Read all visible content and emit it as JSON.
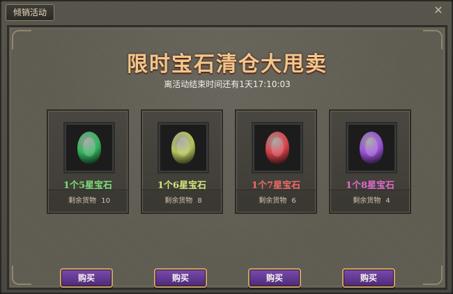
{
  "window": {
    "tab_label": "倾销活动",
    "close_symbol": "✕"
  },
  "main": {
    "title": "限时宝石清仓大甩卖",
    "timer_text": "离活动结束时间还有1天17:10:03"
  },
  "offers": [
    {
      "name": "1个5星宝石",
      "stock_label": "剩余货物",
      "stock_value": "10",
      "gem_color": "#32b35d",
      "name_color": "#7de07a",
      "buy_label": "购买"
    },
    {
      "name": "1个6星宝石",
      "stock_label": "剩余货物",
      "stock_value": "8",
      "gem_color": "#b6c35a",
      "name_color": "#d7e67a",
      "buy_label": "购买"
    },
    {
      "name": "1个7星宝石",
      "stock_label": "剩余货物",
      "stock_value": "6",
      "gem_color": "#d8424a",
      "name_color": "#f26a6a",
      "buy_label": "购买"
    },
    {
      "name": "1个8星宝石",
      "stock_label": "剩余货物",
      "stock_value": "4",
      "gem_color": "#9a52d8",
      "name_color": "#e06bd0",
      "buy_label": "购买"
    }
  ]
}
